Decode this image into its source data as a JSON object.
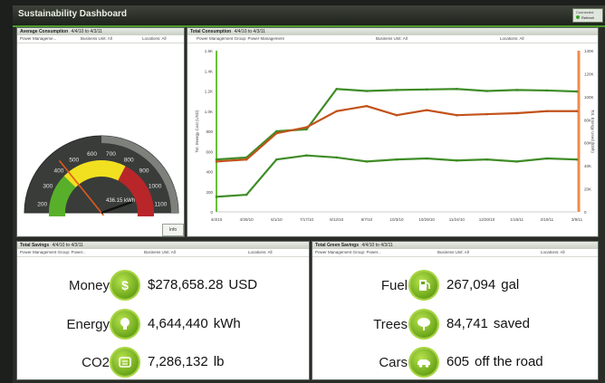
{
  "app": {
    "title": "Sustainability Dashboard",
    "status_line1": "Connected",
    "status_line2": "Refresh"
  },
  "avg_panel": {
    "title": "Average Consumption",
    "date_range": "4/4/10 to 4/3/11",
    "filter_group": "Power Manageme...",
    "filter_unit": "Business Unit: All",
    "filter_location": "Locations: All",
    "gauge": {
      "ticks": [
        "100",
        "200",
        "300",
        "400",
        "500",
        "600",
        "700",
        "800",
        "900",
        "1000",
        "1100",
        "1200"
      ],
      "readout": "436.15 kWh",
      "value": 436.15,
      "min": 100,
      "max": 1200
    },
    "info_label": "Info"
  },
  "total_panel": {
    "title": "Total Consumption",
    "date_range": "4/4/10 to 4/3/11",
    "filter_group": "Power Management Group: Power Management",
    "filter_unit": "Business Unit: All",
    "filter_location": "Locations: All",
    "chart_data": {
      "type": "line",
      "ylabel_left": "Tot. Energy Cost (USD)",
      "ylabel_right": "Tot. Energy Used (kWh)",
      "y_left_ticks": [
        "0",
        "200",
        "400",
        "600",
        "800",
        "1.0K",
        "1.2K",
        "1.4K",
        "1.6K"
      ],
      "y_right_ticks": [
        "0",
        "20K",
        "40K",
        "60K",
        "80K",
        "100K",
        "120K",
        "140K"
      ],
      "x_ticks": [
        "4/4/10",
        "4/30/10",
        "6/1/10",
        "7/17/10",
        "8/12/10",
        "9/7/10",
        "10/3/10",
        "10/29/10",
        "11/24/10",
        "12/20/10",
        "1/15/11",
        "2/10/11",
        "3/8/11"
      ],
      "series": [
        {
          "color": "#3e8c26",
          "values": [
            520,
            540,
            800,
            820,
            1220,
            1200,
            1210,
            1215,
            1220,
            1200,
            1210,
            1205,
            1195
          ]
        },
        {
          "color": "#c2521a",
          "values": [
            500,
            520,
            780,
            840,
            1000,
            1050,
            960,
            1010,
            960,
            970,
            980,
            1000,
            1000
          ]
        },
        {
          "color": "#3e8c26",
          "values": [
            150,
            170,
            520,
            560,
            540,
            500,
            520,
            530,
            510,
            520,
            500,
            530,
            520
          ]
        }
      ]
    }
  },
  "savings_panel": {
    "title": "Total Savings",
    "date_range": "4/4/10 to 4/3/11",
    "filter_group": "Power Management Group: Power...",
    "filter_unit": "Business Unit: All",
    "filter_location": "Locations: All",
    "metrics": [
      {
        "label": "Money",
        "icon": "dollar-icon",
        "value": "$278,658.28",
        "unit": "USD"
      },
      {
        "label": "Energy",
        "icon": "lightbulb-icon",
        "value": "4,644,440",
        "unit": "kWh"
      },
      {
        "label": "CO2",
        "icon": "co2-icon",
        "value": "7,286,132",
        "unit": "lb"
      }
    ]
  },
  "green_panel": {
    "title": "Total Green Savings",
    "date_range": "4/4/10 to 4/3/11",
    "filter_group": "Power Management Group: Power...",
    "filter_unit": "Business Unit: All",
    "filter_location": "Locations: All",
    "metrics": [
      {
        "label": "Fuel",
        "icon": "fuel-pump-icon",
        "value": "267,094",
        "unit": "gal"
      },
      {
        "label": "Trees",
        "icon": "tree-icon",
        "value": "84,741",
        "unit": "saved"
      },
      {
        "label": "Cars",
        "icon": "car-icon",
        "value": "605",
        "unit": "off the road"
      }
    ]
  }
}
